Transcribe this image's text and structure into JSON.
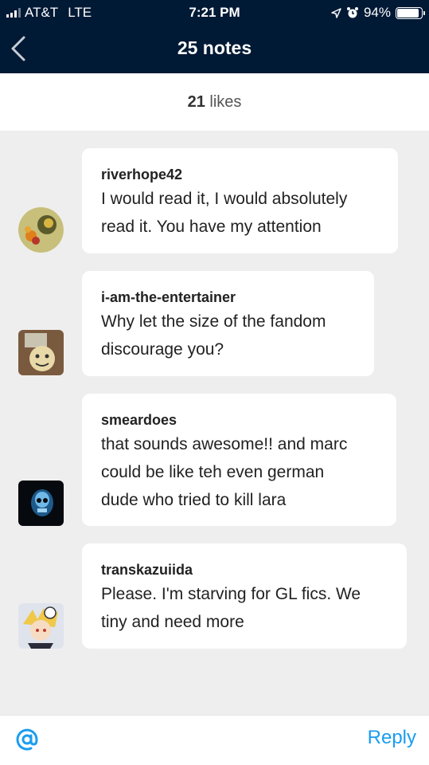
{
  "status_bar": {
    "carrier": "AT&T",
    "network": "LTE",
    "time": "7:21 PM",
    "battery": "94%",
    "location_icon": "location-arrow-icon",
    "alarm_icon": "alarm-clock-icon"
  },
  "header": {
    "title": "25 notes",
    "back_icon": "chevron-left-icon"
  },
  "likes": {
    "count": "21",
    "label": "likes"
  },
  "notes": [
    {
      "username": "riverhope42",
      "lines": [
        "I would read it, I would absolutely",
        "read it. You have my attention"
      ]
    },
    {
      "username": "i-am-the-entertainer",
      "lines": [
        "Why let the size of the fandom",
        "discourage you?"
      ]
    },
    {
      "username": "smeardoes",
      "lines": [
        "that sounds awesome!! and marc",
        "could be like teh even german",
        "dude who tried to kill lara"
      ]
    },
    {
      "username": "transkazuiida",
      "lines": [
        "Please. I'm starving for GL fics. We",
        "tiny and need more"
      ]
    }
  ],
  "footer": {
    "mention_icon": "at-sign-icon",
    "reply_label": "Reply"
  },
  "colors": {
    "header_bg": "#001935",
    "accent": "#1a9df0",
    "feed_bg": "#eeeeee"
  }
}
